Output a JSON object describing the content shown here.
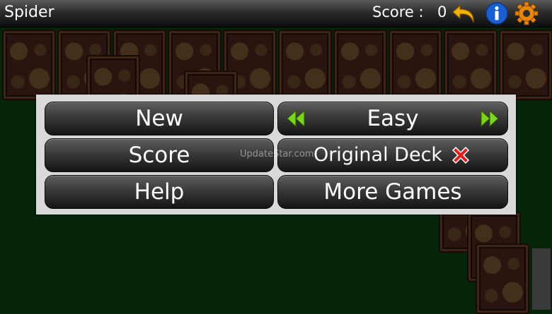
{
  "header": {
    "title": "Spider",
    "score_label": "Score :",
    "score_value": "0",
    "icons": [
      "undo-arrow-icon",
      "info-icon",
      "settings-gear-icon"
    ]
  },
  "menu": {
    "new_label": "New",
    "score_label": "Score",
    "help_label": "Help",
    "difficulty_label": "Easy",
    "deck_label": "Original Deck",
    "more_games_label": "More Games"
  },
  "watermark": "UpdateStar.com",
  "colors": {
    "table_green": "#06240a",
    "menu_panel": "#d9d9d9",
    "arrow_green": "#7ed321",
    "close_red": "#e02020",
    "info_blue": "#1a5fd0",
    "undo_yellow": "#f2b300"
  }
}
